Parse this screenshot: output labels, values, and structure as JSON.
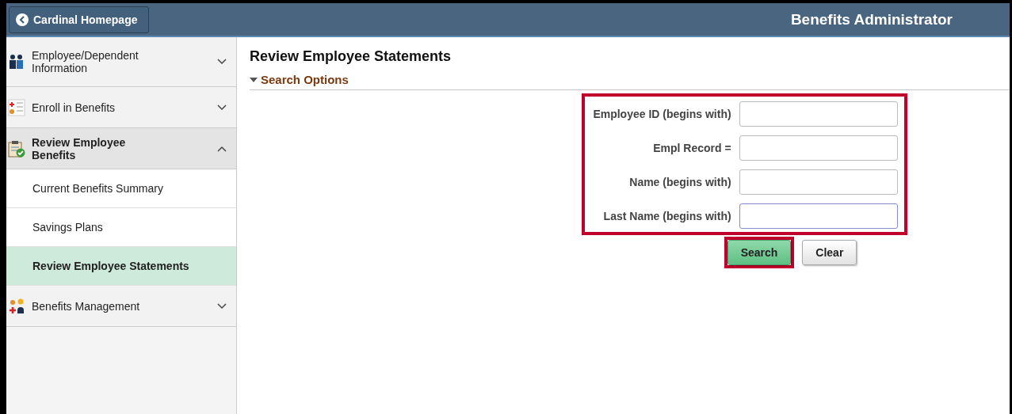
{
  "header": {
    "back_button": "Cardinal Homepage",
    "title": "Benefits Administrator"
  },
  "sidebar": {
    "items": [
      {
        "label": "Employee/Dependent Information",
        "expanded": false
      },
      {
        "label": "Enroll in Benefits",
        "expanded": false
      },
      {
        "label": "Review Employee Benefits",
        "expanded": true,
        "children": [
          {
            "label": "Current Benefits Summary",
            "selected": false
          },
          {
            "label": "Savings Plans",
            "selected": false
          },
          {
            "label": "Review Employee Statements",
            "selected": true
          }
        ]
      },
      {
        "label": "Benefits Management",
        "expanded": false
      }
    ]
  },
  "page_title": "Review Employee Statements",
  "search_options": {
    "label": "Search Options",
    "expanded": true,
    "highlighted": true,
    "fields": [
      {
        "label": "Employee ID (begins with)",
        "focused": false
      },
      {
        "label": "Empl Record =",
        "focused": false
      },
      {
        "label": "Name (begins with)",
        "focused": false
      },
      {
        "label": "Last Name (begins with)",
        "focused": true
      }
    ]
  },
  "buttons": [
    {
      "label": "Search",
      "kind": "primary",
      "highlighted": true
    },
    {
      "label": "Clear",
      "kind": "secondary",
      "highlighted": false
    }
  ]
}
